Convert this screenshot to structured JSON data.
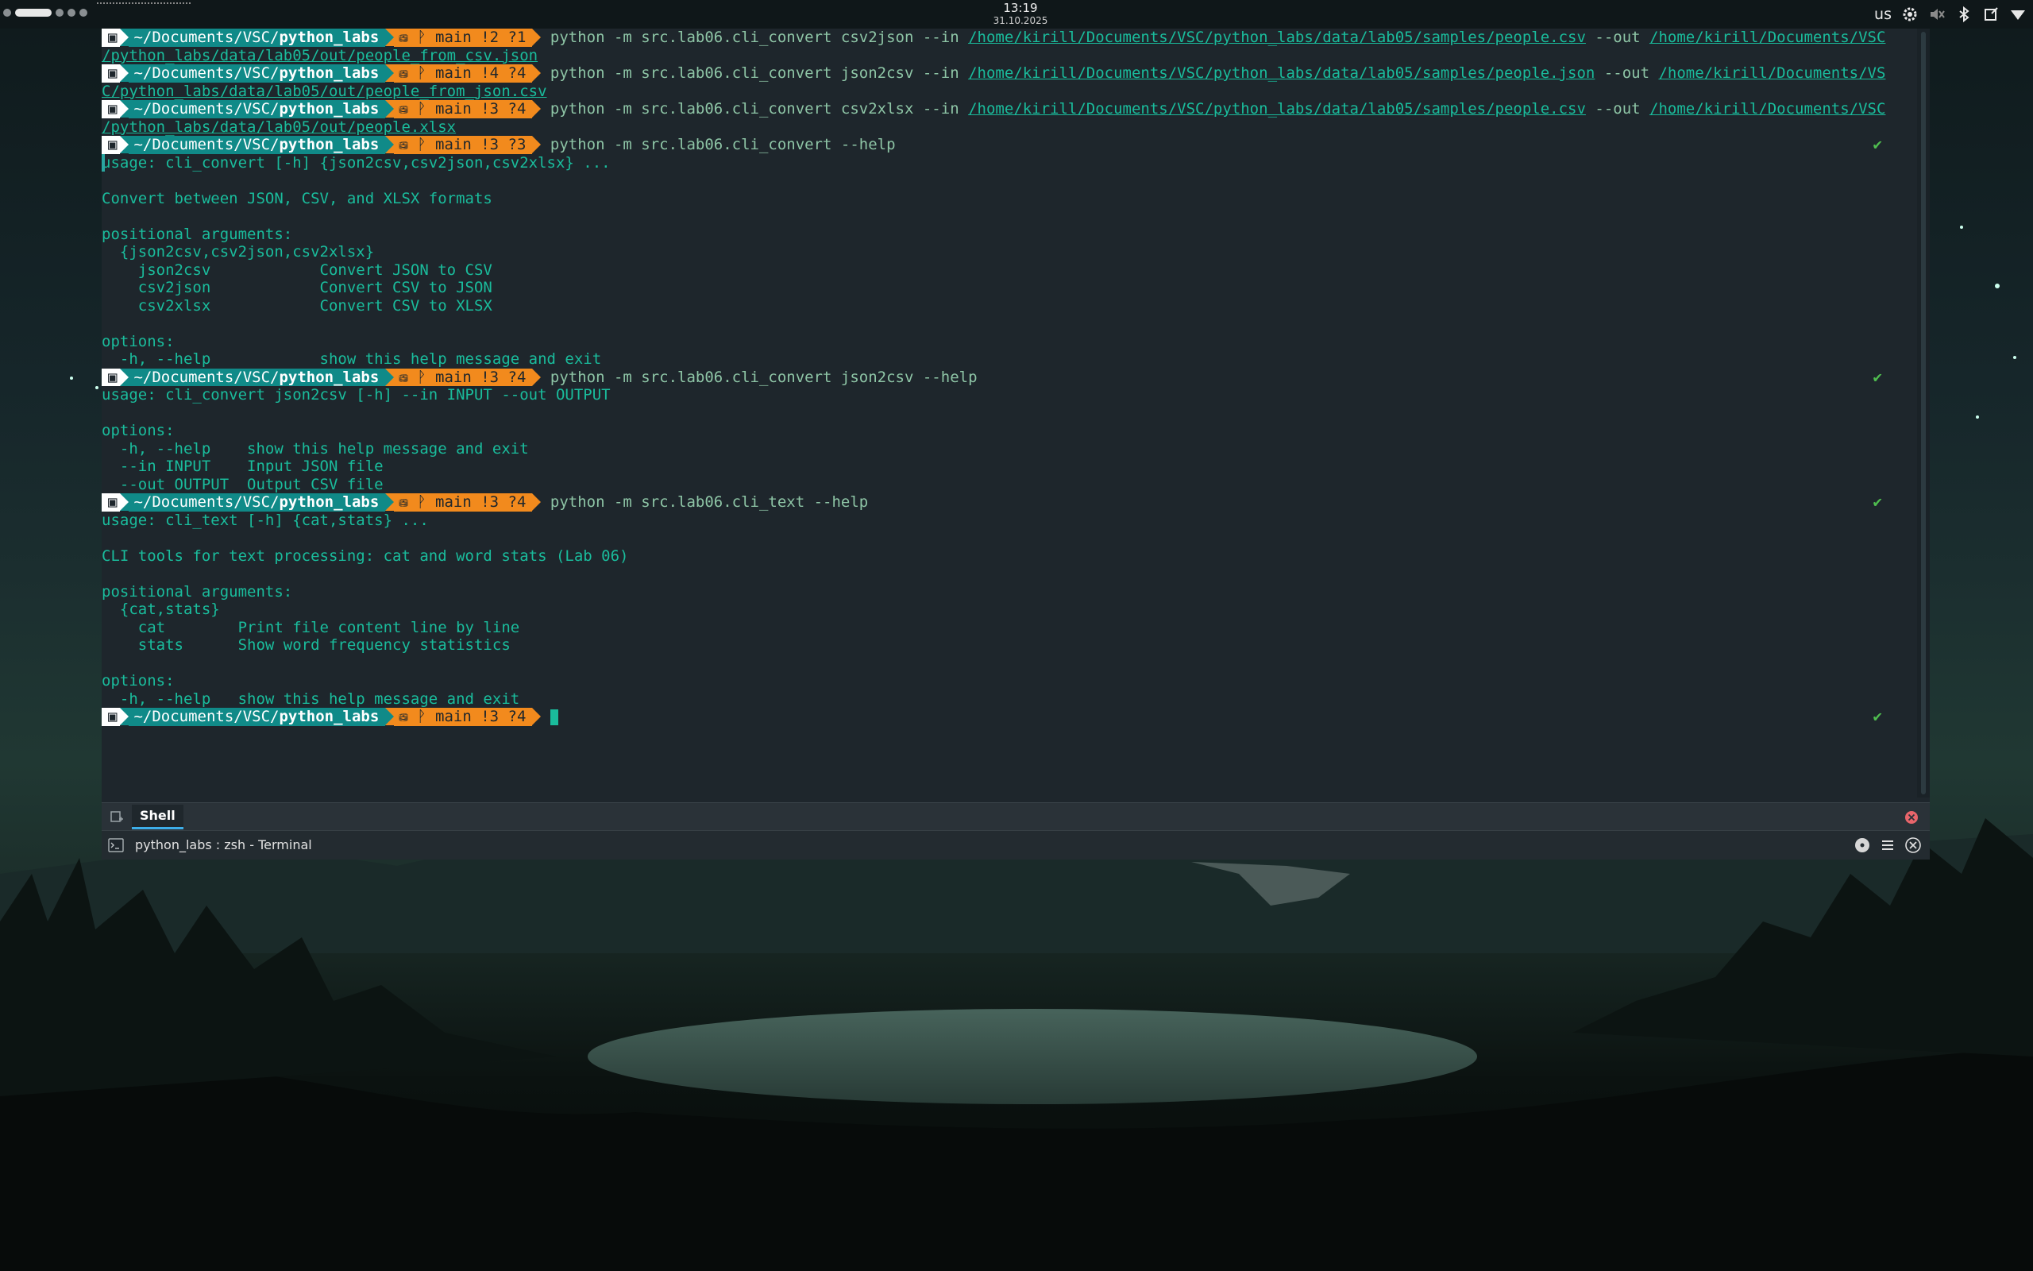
{
  "top_panel": {
    "time": "13:19",
    "date": "31.10.2025",
    "keyboard_layout": "us"
  },
  "prompt": {
    "os_icon": "▣",
    "path_prefix": "~/Documents/VSC/",
    "path_bold": "python_labs",
    "git_branch_glyph": "⛁ ᚹ main"
  },
  "terminal_lines": [
    {
      "kind": "prompt",
      "git_status": "!2 ?1",
      "command": "python -m src.lab06.cli_convert csv2json --in ",
      "path1": "/home/kirill/Documents/VSC/python_labs/data/lab05/samples/people.csv",
      "mid": " --out ",
      "path2": "/home/kirill/Documents/VSC"
    },
    {
      "kind": "wrap",
      "text": "/python_labs/data/lab05/out/people_from_csv.json"
    },
    {
      "kind": "prompt",
      "git_status": "!4 ?4",
      "command": "python -m src.lab06.cli_convert json2csv --in ",
      "path1": "/home/kirill/Documents/VSC/python_labs/data/lab05/samples/people.json",
      "mid": " --out ",
      "path2": "/home/kirill/Documents/VS"
    },
    {
      "kind": "wrap",
      "text": "C/python_labs/data/lab05/out/people_from_json.csv"
    },
    {
      "kind": "prompt",
      "git_status": "!3 ?4",
      "command": "python -m src.lab06.cli_convert csv2xlsx --in ",
      "path1": "/home/kirill/Documents/VSC/python_labs/data/lab05/samples/people.csv",
      "mid": " --out ",
      "path2": "/home/kirill/Documents/VSC"
    },
    {
      "kind": "wrap",
      "text": "/python_labs/data/lab05/out/people.xlsx"
    },
    {
      "kind": "prompt",
      "git_status": "!3 ?3",
      "command": "python -m src.lab06.cli_convert --help",
      "check": "✔"
    },
    {
      "kind": "out",
      "text": "usage: cli_convert [-h] {json2csv,csv2json,csv2xlsx} ...",
      "cursorline": true
    },
    {
      "kind": "out",
      "text": ""
    },
    {
      "kind": "out",
      "text": "Convert between JSON, CSV, and XLSX formats"
    },
    {
      "kind": "out",
      "text": ""
    },
    {
      "kind": "out",
      "text": "positional arguments:"
    },
    {
      "kind": "out",
      "text": "  {json2csv,csv2json,csv2xlsx}"
    },
    {
      "kind": "out",
      "text": "    json2csv            Convert JSON to CSV"
    },
    {
      "kind": "out",
      "text": "    csv2json            Convert CSV to JSON"
    },
    {
      "kind": "out",
      "text": "    csv2xlsx            Convert CSV to XLSX"
    },
    {
      "kind": "out",
      "text": ""
    },
    {
      "kind": "out",
      "text": "options:"
    },
    {
      "kind": "out",
      "text": "  -h, --help            show this help message and exit"
    },
    {
      "kind": "prompt",
      "git_status": "!3 ?4",
      "command": "python -m src.lab06.cli_convert json2csv --help",
      "check": "✔"
    },
    {
      "kind": "out",
      "text": "usage: cli_convert json2csv [-h] --in INPUT --out OUTPUT"
    },
    {
      "kind": "out",
      "text": ""
    },
    {
      "kind": "out",
      "text": "options:"
    },
    {
      "kind": "out",
      "text": "  -h, --help    show this help message and exit"
    },
    {
      "kind": "out",
      "text": "  --in INPUT    Input JSON file"
    },
    {
      "kind": "out",
      "text": "  --out OUTPUT  Output CSV file"
    },
    {
      "kind": "prompt",
      "git_status": "!3 ?4",
      "command": "python -m src.lab06.cli_text --help",
      "check": "✔"
    },
    {
      "kind": "out",
      "text": "usage: cli_text [-h] {cat,stats} ..."
    },
    {
      "kind": "out",
      "text": ""
    },
    {
      "kind": "out",
      "text": "CLI tools for text processing: cat and word stats (Lab 06)"
    },
    {
      "kind": "out",
      "text": ""
    },
    {
      "kind": "out",
      "text": "positional arguments:"
    },
    {
      "kind": "out",
      "text": "  {cat,stats}"
    },
    {
      "kind": "out",
      "text": "    cat        Print file content line by line"
    },
    {
      "kind": "out",
      "text": "    stats      Show word frequency statistics"
    },
    {
      "kind": "out",
      "text": ""
    },
    {
      "kind": "out",
      "text": "options:"
    },
    {
      "kind": "out",
      "text": "  -h, --help   show this help message and exit"
    },
    {
      "kind": "prompt",
      "git_status": "!3 ?4",
      "command": "",
      "check": "✔",
      "cursor": true
    }
  ],
  "tab_bar": {
    "tab_label": "Shell"
  },
  "title_bar": {
    "title": "python_labs : zsh - Terminal"
  },
  "icons": {
    "new_tab": "new-tab-icon",
    "close_tab": "close-icon",
    "terminal": "terminal-icon",
    "settings": "gear-icon",
    "bluetooth": "bluetooth-icon",
    "volume_muted": "volume-muted-icon"
  },
  "colors": {
    "terminal_bg": "#1e262c",
    "terminal_fg": "#1abc9c",
    "prompt_path_bg": "#108a88",
    "prompt_git_bg": "#f28a1d",
    "accent": "#3daee9",
    "check_green": "#4fbe4f"
  }
}
